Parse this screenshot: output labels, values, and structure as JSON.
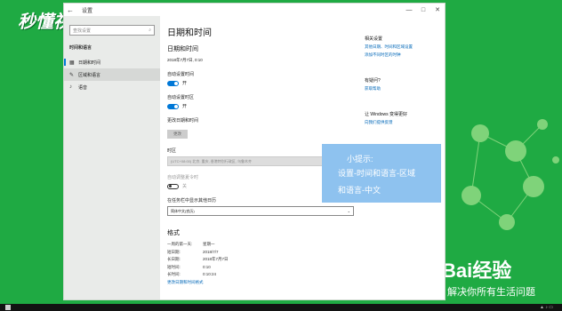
{
  "watermark": {
    "brand": "秒懂视频"
  },
  "baidu": {
    "logo": "Bai经验",
    "slogan": "解决你所有生活问题"
  },
  "window": {
    "title": "设置",
    "controls": {
      "minimize": "—",
      "maximize": "□",
      "close": "✕"
    }
  },
  "sidebar": {
    "search_placeholder": "查找设置",
    "header": "时间和语言",
    "items": [
      {
        "label": "日期和时间",
        "icon": "calendar-icon"
      },
      {
        "label": "区域和语言",
        "icon": "language-icon"
      },
      {
        "label": "语音",
        "icon": "microphone-icon"
      }
    ]
  },
  "main": {
    "title": "日期和时间",
    "section_title": "日期和时间",
    "current_datetime": "2018年7月7日, 0:10",
    "auto_time_label": "自动设置时间",
    "auto_time_state": "开",
    "auto_tz_label": "自动设置时区",
    "auto_tz_state": "开",
    "change_dt_label": "更改日期和时间",
    "change_btn": "更改",
    "timezone_label": "时区",
    "timezone_value": "(UTC+08:00) 北京, 重庆, 香港特别行政区, 乌鲁木齐",
    "dst_label": "自动调整夏令时",
    "dst_state": "关",
    "taskbar_cal_label": "在任务栏中显示其他日历",
    "taskbar_cal_value": "简体中文(农历)",
    "format_title": "格式",
    "formats": [
      {
        "k": "一周的第一天:",
        "v": "星期一"
      },
      {
        "k": "短日期:",
        "v": "2018/7/7"
      },
      {
        "k": "长日期:",
        "v": "2018年7月7日"
      },
      {
        "k": "短时间:",
        "v": "0:10"
      },
      {
        "k": "长时间:",
        "v": "0:10:24"
      }
    ],
    "change_format_link": "更改日期和时间格式"
  },
  "right_panel": {
    "related_title": "相关设置",
    "related_links": [
      "其他日期、时间和区域设置",
      "添加不同时区的时钟"
    ],
    "help_title": "有疑问?",
    "help_link": "获取帮助",
    "improve_title": "让 Windows 变得更好",
    "improve_link": "向我们提供反馈"
  },
  "tip": {
    "line1": "小提示:",
    "line2": "设置-时间和语言-区域",
    "line3": "和语言-中文"
  }
}
